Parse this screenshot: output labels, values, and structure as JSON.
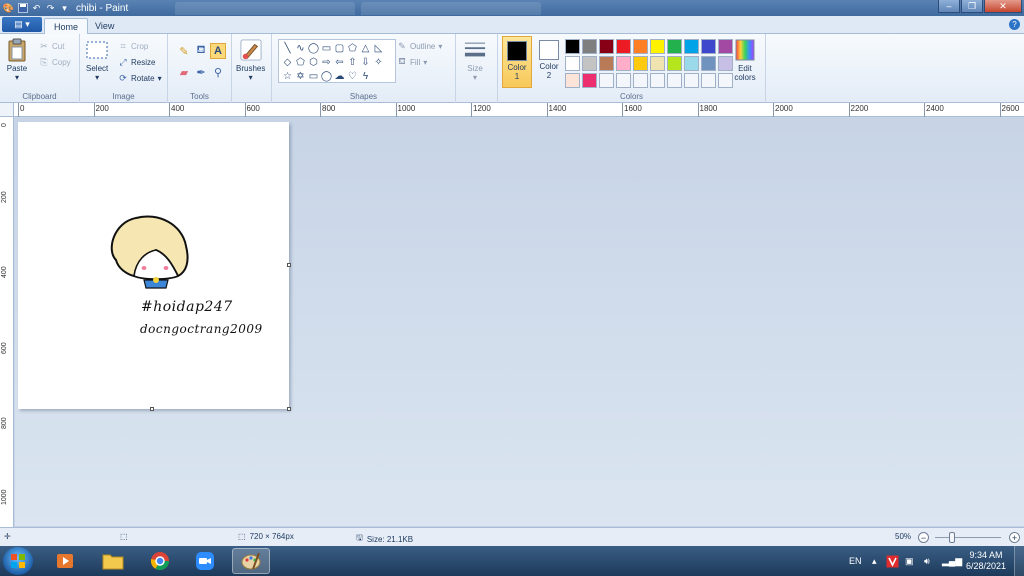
{
  "window": {
    "title": "chibi - Paint"
  },
  "ribbon": {
    "file_label": "▤ ▾",
    "tabs": [
      {
        "label": "Home"
      },
      {
        "label": "View"
      }
    ],
    "clipboard": {
      "paste": "Paste",
      "cut": "Cut",
      "copy": "Copy",
      "group": "Clipboard"
    },
    "image": {
      "select": "Select",
      "crop": "Crop",
      "resize": "Resize",
      "rotate": "Rotate",
      "group": "Image"
    },
    "tools": {
      "group": "Tools"
    },
    "brushes": {
      "label": "Brushes"
    },
    "shapes": {
      "outline": "Outline",
      "fill": "Fill",
      "group": "Shapes"
    },
    "size": {
      "label": "Size"
    },
    "colors": {
      "color1_label": "Color",
      "color1_num": "1",
      "color2_label": "Color",
      "color2_num": "2",
      "edit_label": "Edit",
      "edit_label2": "colors",
      "group": "Colors",
      "color1": "#000000",
      "color2": "#ffffff",
      "palette": [
        "#000000",
        "#7f7f7f",
        "#880015",
        "#ed1c24",
        "#ff7f27",
        "#fff200",
        "#22b14c",
        "#00a2e8",
        "#3f48cc",
        "#a349a4",
        "#ffffff",
        "#c3c3c3",
        "#b97a57",
        "#ffaec9",
        "#ffc90e",
        "#efe4b0",
        "#b5e61d",
        "#99d9ea",
        "#7092be",
        "#c8bfe7",
        "#fde4d8",
        "#ec2e6e",
        "#f3f6fa",
        "#f3f6fa",
        "#f3f6fa",
        "#f3f6fa",
        "#f3f6fa",
        "#f3f6fa",
        "#f3f6fa",
        "#f3f6fa"
      ]
    }
  },
  "ruler": {
    "h_labels": [
      "0",
      "200",
      "400",
      "600",
      "800",
      "1000",
      "1200",
      "1400",
      "1600",
      "1800",
      "2000",
      "2200",
      "2400",
      "2600"
    ],
    "v_labels": [
      "0",
      "200",
      "400",
      "600",
      "800",
      "1000"
    ]
  },
  "canvas": {
    "hashtag": "#hoidap247",
    "author": "docngoctrang2009"
  },
  "statusbar": {
    "dimensions": "720 × 764px",
    "size": "Size: 21.1KB",
    "zoom": "50%"
  },
  "taskbar": {
    "lang": "EN",
    "time": "9:34 AM",
    "date": "6/28/2021"
  }
}
